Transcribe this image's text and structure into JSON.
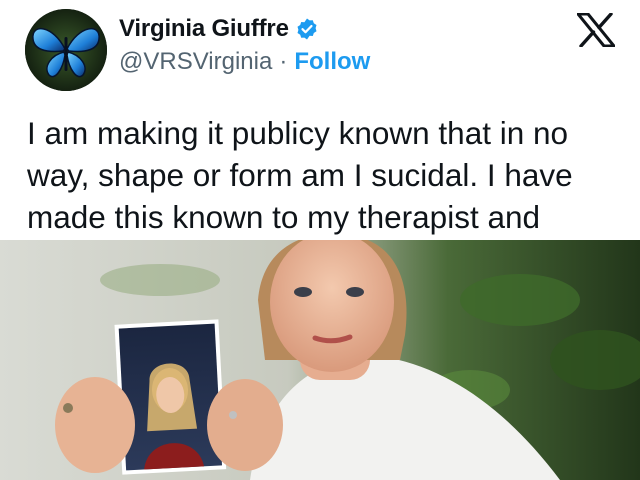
{
  "author": {
    "display_name": "Virginia Giuffre",
    "handle": "@VRSVirginia",
    "separator": "·",
    "follow_label": "Follow",
    "avatar_icon": "blue-butterfly-avatar",
    "verified_icon": "verified-badge-icon",
    "verified_color": "#1d9bf0"
  },
  "platform": {
    "logo_icon": "x-logo-icon"
  },
  "tweet": {
    "text": "I am making it publicy known that in no\nway, shape or form am I sucidal. I have\nmade this known to my therapist and\nGP - if something happens to me - in the"
  },
  "media": {
    "image_icon": "attached-photo"
  },
  "colors": {
    "text": "#0f1419",
    "secondary": "#536471",
    "link": "#1d9bf0"
  }
}
